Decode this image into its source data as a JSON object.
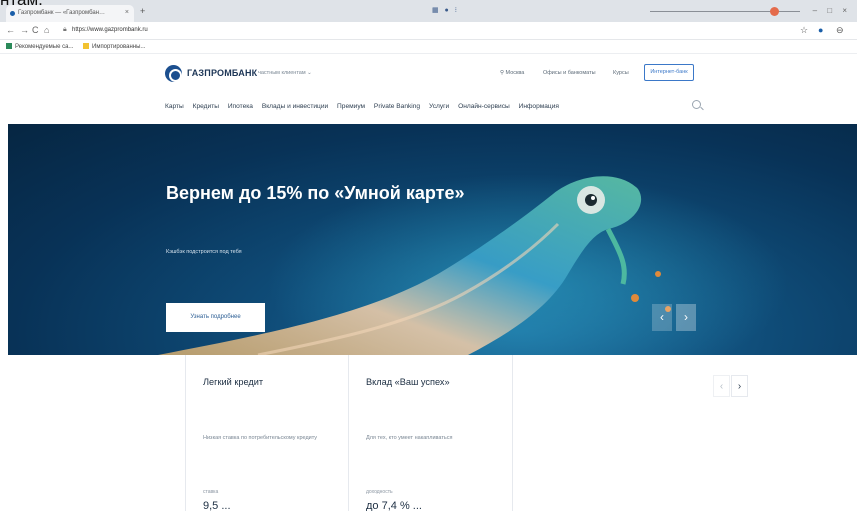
{
  "stray_caption": "нтам.",
  "browser": {
    "tab_title": "Газпромбанк — «Газпромбан…",
    "tab_close": "×",
    "new_tab": "+",
    "url": "https://www.gazprombank.ru",
    "bookmarks": [
      "Рекомендуемые са...",
      "Импортированны..."
    ],
    "window_controls": "– □ ×"
  },
  "site": {
    "brand": "ГАЗПРОМБАНК",
    "client_selector": "частным клиентам ⌄",
    "city": "⚲ Москва",
    "offices": "Офисы и банкоматы",
    "rates": "Курсы",
    "ibank": "Интернет-банк",
    "nav": [
      "Карты",
      "Кредиты",
      "Ипотека",
      "Вклады и инвестиции",
      "Премиум",
      "Private Banking",
      "Услуги",
      "Онлайн-сервисы",
      "Информация"
    ]
  },
  "hero": {
    "title": "Вернем до 15% по «Умной карте»",
    "subtitle": "Кэшбэк подстроится под тебя",
    "button": "Узнать подробнее",
    "prev": "‹",
    "next": "›"
  },
  "cards": [
    {
      "title": "Легкий кредит",
      "desc": "Низкая ставка по потребительскому кредиту",
      "kind": "ставка",
      "value": "9,5 ..."
    },
    {
      "title": "Вклад «Ваш успех»",
      "desc": "Для тех, кто умеет накапливаться",
      "kind": "доходность",
      "value": "до 7,4 % ..."
    }
  ],
  "card_nav": {
    "prev": "‹",
    "next": "›"
  },
  "colors": {
    "brand": "#1c4f8f",
    "hero_bg": "#0f4c78",
    "accent_link": "#3b78c8"
  }
}
